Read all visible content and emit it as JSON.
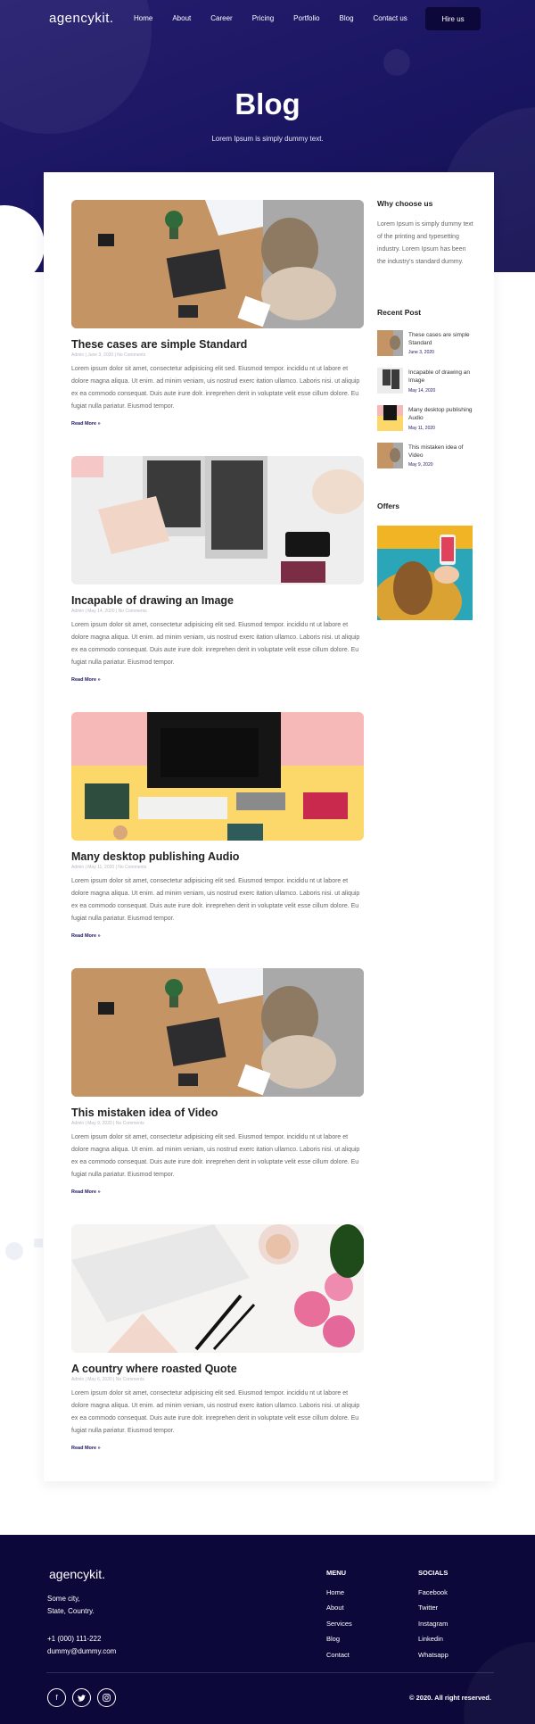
{
  "header": {
    "logo": "agencykit.",
    "nav": [
      "Home",
      "About",
      "Career",
      "Pricing",
      "Portfolio",
      "Blog",
      "Contact us"
    ],
    "cta": "Hire us"
  },
  "hero": {
    "title": "Blog",
    "subtitle": "Lorem Ipsum is simply dummy text."
  },
  "posts": [
    {
      "title": "These cases are simple Standard",
      "meta": "Admin | June 3, 2020 | No Comments",
      "body": "Lorem ipsum dolor sit amet, consectetur adipisicing elit sed. Eiusmod tempor. incididu nt ut labore et dolore magna aliqua. Ut enim. ad minim veniam, uis nostrud exerc itation ullamco. Laboris nisi. ut aliquip ex ea commodo consequat. Duis aute irure dolr. inreprehen derit in voluptate velit esse cillum dolore. Eu fugiat nulla pariatur. Eiusmod tempor.",
      "more": "Read More »"
    },
    {
      "title": "Incapable of drawing an Image",
      "meta": "Admin | May 14, 2020 | No Comments",
      "body": "Lorem ipsum dolor sit amet, consectetur adipisicing elit sed. Eiusmod tempor. incididu nt ut labore et dolore magna aliqua. Ut enim. ad minim veniam, uis nostrud exerc itation ullamco. Laboris nisi. ut aliquip ex ea commodo consequat. Duis aute irure dolr. inreprehen derit in voluptate velit esse cillum dolore. Eu fugiat nulla pariatur. Eiusmod tempor.",
      "more": "Read More »"
    },
    {
      "title": "Many desktop publishing Audio",
      "meta": "Admin | May 11, 2020 | No Comments",
      "body": "Lorem ipsum dolor sit amet, consectetur adipisicing elit sed. Eiusmod tempor. incididu nt ut labore et dolore magna aliqua. Ut enim. ad minim veniam, uis nostrud exerc itation ullamco. Laboris nisi. ut aliquip ex ea commodo consequat. Duis aute irure dolr. inreprehen derit in voluptate velit esse cillum dolore. Eu fugiat nulla pariatur. Eiusmod tempor.",
      "more": "Read More »"
    },
    {
      "title": "This mistaken idea of Video",
      "meta": "Admin | May 9, 2020 | No Comments",
      "body": "Lorem ipsum dolor sit amet, consectetur adipisicing elit sed. Eiusmod tempor. incididu nt ut labore et dolore magna aliqua. Ut enim. ad minim veniam, uis nostrud exerc itation ullamco. Laboris nisi. ut aliquip ex ea commodo consequat. Duis aute irure dolr. inreprehen derit in voluptate velit esse cillum dolore. Eu fugiat nulla pariatur. Eiusmod tempor.",
      "more": "Read More »"
    },
    {
      "title": "A country where roasted Quote",
      "meta": "Admin | May 6, 2020 | No Comments",
      "body": "Lorem ipsum dolor sit amet, consectetur adipisicing elit sed. Eiusmod tempor. incididu nt ut labore et dolore magna aliqua. Ut enim. ad minim veniam, uis nostrud exerc itation ullamco. Laboris nisi. ut aliquip ex ea commodo consequat. Duis aute irure dolr. inreprehen derit in voluptate velit esse cillum dolore. Eu fugiat nulla pariatur. Eiusmod tempor.",
      "more": "Read More »"
    }
  ],
  "sidebar": {
    "why_title": "Why choose us",
    "why_text": "Lorem Ipsum is simply dummy text of the printing and typesetting industry. Lorem Ipsum has been the industry's standard dummy.",
    "recent_title": "Recent Post",
    "recent": [
      {
        "title": "These cases are simple Standard",
        "date": "June 3, 2020"
      },
      {
        "title": "Incapable of drawing an Image",
        "date": "May 14, 2020"
      },
      {
        "title": "Many desktop publishing Audio",
        "date": "May 11, 2020"
      },
      {
        "title": "This mistaken idea of Video",
        "date": "May 9, 2020"
      }
    ],
    "offers_title": "Offers"
  },
  "footer": {
    "logo": "agencykit.",
    "address_line1": "Some city,",
    "address_line2": "State, Country.",
    "phone": "+1 (000) 111-222",
    "email": "dummy@dummy.com",
    "menu_title": "MENU",
    "menu": [
      "Home",
      "About",
      "Services",
      "Blog",
      "Contact"
    ],
    "socials_title": "SOCIALS",
    "socials": [
      "Facebook",
      "Twitter",
      "Instagram",
      "Linkedin",
      "Whatsapp"
    ],
    "copyright": "© 2020. All right reserved."
  },
  "colors": {
    "hero_bg": "#1a1561",
    "button_dark": "#0c0839",
    "footer_bg": "#0c0839",
    "accent": "#1b1760"
  }
}
